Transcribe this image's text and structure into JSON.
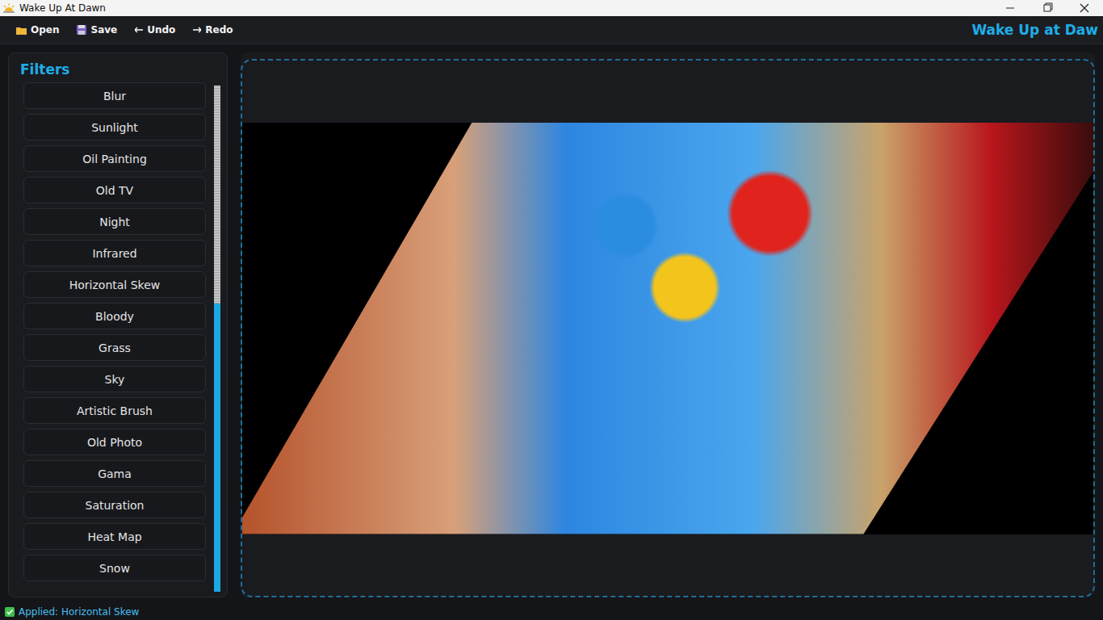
{
  "window": {
    "title": "Wake Up At Dawn"
  },
  "toolbar": [
    {
      "label": "Open"
    },
    {
      "label": "Save"
    },
    {
      "label": "Undo"
    },
    {
      "label": "Redo"
    }
  ],
  "brand": "Wake Up at Daw",
  "sidebar": {
    "title": "Filters",
    "items": [
      {
        "label": "Blur"
      },
      {
        "label": "Sunlight"
      },
      {
        "label": "Oil Painting"
      },
      {
        "label": "Old TV"
      },
      {
        "label": "Night"
      },
      {
        "label": "Infrared"
      },
      {
        "label": "Horizontal Skew"
      },
      {
        "label": "Bloody"
      },
      {
        "label": "Grass"
      },
      {
        "label": "Sky"
      },
      {
        "label": "Artistic Brush"
      },
      {
        "label": "Old Photo"
      },
      {
        "label": "Gama"
      },
      {
        "label": "Saturation"
      },
      {
        "label": "Heat Map"
      },
      {
        "label": "Snow"
      }
    ],
    "scrollbar": {
      "level": 0.57
    }
  },
  "status_bar": {
    "text": "Applied: Horizontal Skew",
    "ok": true
  }
}
